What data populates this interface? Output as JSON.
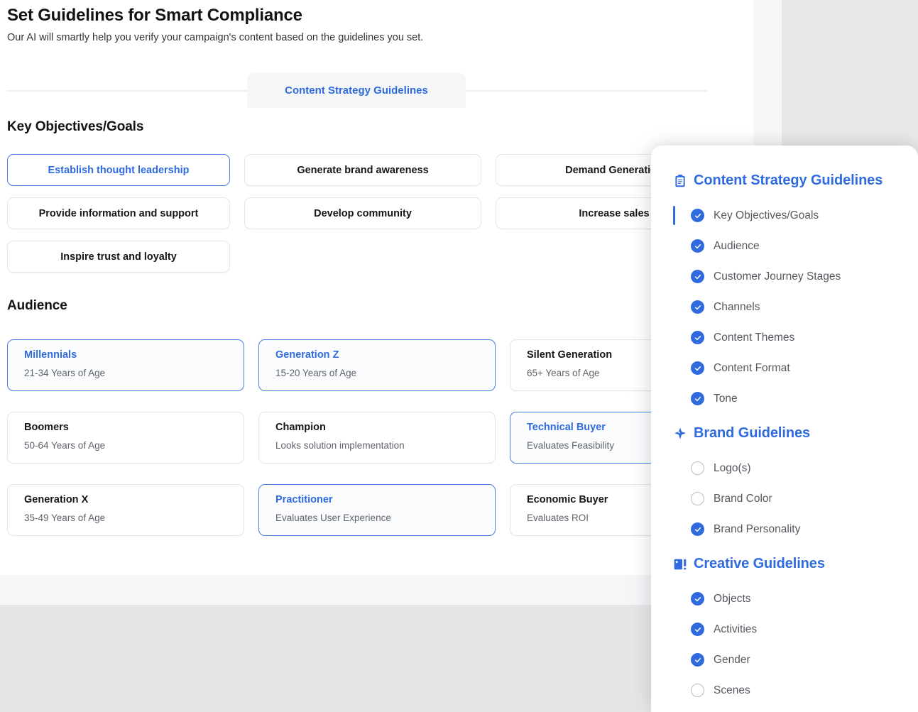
{
  "header": {
    "title": "Set Guidelines for Smart Compliance",
    "subtitle": "Our AI will smartly help you verify your campaign's content based on the guidelines you set."
  },
  "tabs": [
    {
      "label": "Content Strategy Guidelines",
      "active": true
    }
  ],
  "sections": {
    "objectives": {
      "title": "Key Objectives/Goals",
      "items": [
        {
          "label": "Establish thought leadership",
          "selected": true
        },
        {
          "label": "Generate brand awareness",
          "selected": false
        },
        {
          "label": "Demand Generation",
          "selected": false
        },
        {
          "label": "Provide information and support",
          "selected": false
        },
        {
          "label": "Develop community",
          "selected": false
        },
        {
          "label": "Increase sales",
          "selected": false
        },
        {
          "label": "Inspire trust and loyalty",
          "selected": false
        }
      ]
    },
    "audience": {
      "title": "Audience",
      "items": [
        {
          "title": "Millennials",
          "sub": "21-34 Years of Age",
          "selected": true
        },
        {
          "title": "Generation Z",
          "sub": "15-20 Years of Age",
          "selected": true
        },
        {
          "title": "Silent Generation",
          "sub": "65+ Years of Age",
          "selected": false
        },
        {
          "title": "Boomers",
          "sub": "50-64 Years of Age",
          "selected": false
        },
        {
          "title": "Champion",
          "sub": "Looks solution implementation",
          "selected": false
        },
        {
          "title": "Technical Buyer",
          "sub": "Evaluates Feasibility",
          "selected": true
        },
        {
          "title": "Generation X",
          "sub": "35-49 Years of Age",
          "selected": false
        },
        {
          "title": "Practitioner",
          "sub": "Evaluates User Experience",
          "selected": true
        },
        {
          "title": "Economic Buyer",
          "sub": "Evaluates ROI",
          "selected": false
        }
      ]
    }
  },
  "panel": {
    "groups": [
      {
        "icon": "clipboard-icon",
        "title": "Content Strategy Guidelines",
        "items": [
          {
            "label": "Key Objectives/Goals",
            "checked": true,
            "active": true
          },
          {
            "label": "Audience",
            "checked": true,
            "active": false
          },
          {
            "label": "Customer Journey Stages",
            "checked": true,
            "active": false
          },
          {
            "label": "Channels",
            "checked": true,
            "active": false
          },
          {
            "label": "Content Themes",
            "checked": true,
            "active": false
          },
          {
            "label": "Content Format",
            "checked": true,
            "active": false
          },
          {
            "label": "Tone",
            "checked": true,
            "active": false
          }
        ]
      },
      {
        "icon": "sparkle-icon",
        "title": "Brand Guidelines",
        "items": [
          {
            "label": "Logo(s)",
            "checked": false,
            "active": false
          },
          {
            "label": "Brand Color",
            "checked": false,
            "active": false
          },
          {
            "label": "Brand Personality",
            "checked": true,
            "active": false
          }
        ]
      },
      {
        "icon": "image-icon",
        "title": "Creative Guidelines",
        "items": [
          {
            "label": "Objects",
            "checked": true,
            "active": false
          },
          {
            "label": "Activities",
            "checked": true,
            "active": false
          },
          {
            "label": "Gender",
            "checked": true,
            "active": false
          },
          {
            "label": "Scenes",
            "checked": false,
            "active": false
          }
        ]
      }
    ]
  },
  "colors": {
    "accent": "#2f6bdf",
    "selected_border": "#4a7fe0",
    "text_primary": "#14171a",
    "text_muted": "#60646b",
    "surface": "#ffffff",
    "panel_bg": "#f5f6f8",
    "page_gray": "#e7e8e9"
  }
}
